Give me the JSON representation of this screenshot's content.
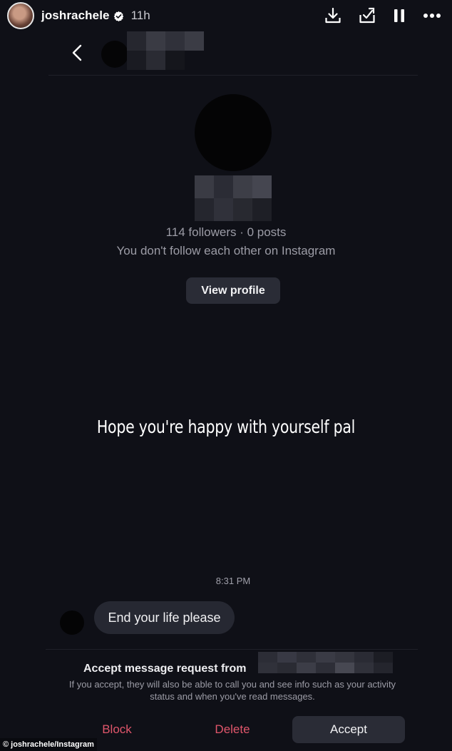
{
  "story": {
    "username": "joshrachele",
    "time_ago": "11h",
    "icons": [
      "download-icon",
      "add-to-story-icon",
      "pause-icon",
      "more-options-icon"
    ],
    "overlay_text": "Hope you're happy with yourself pal"
  },
  "dm": {
    "profile": {
      "stats": "114 followers · 0 posts",
      "follow_note": "You don't follow each other on Instagram",
      "view_profile_label": "View profile"
    },
    "messages": [
      {
        "time": "8:31 PM",
        "text": "End your life please"
      }
    ],
    "request": {
      "title": "Accept message request from",
      "body": "If you accept, they will also be able to call you and see info such as your activity status and when you've read messages.",
      "block_label": "Block",
      "delete_label": "Delete",
      "accept_label": "Accept"
    }
  },
  "credit": "© joshrachele/Instagram",
  "colors": {
    "background": "#0f1017",
    "button": "#2a2c36",
    "destructive": "#e0566b",
    "verified": "#ffffff"
  }
}
